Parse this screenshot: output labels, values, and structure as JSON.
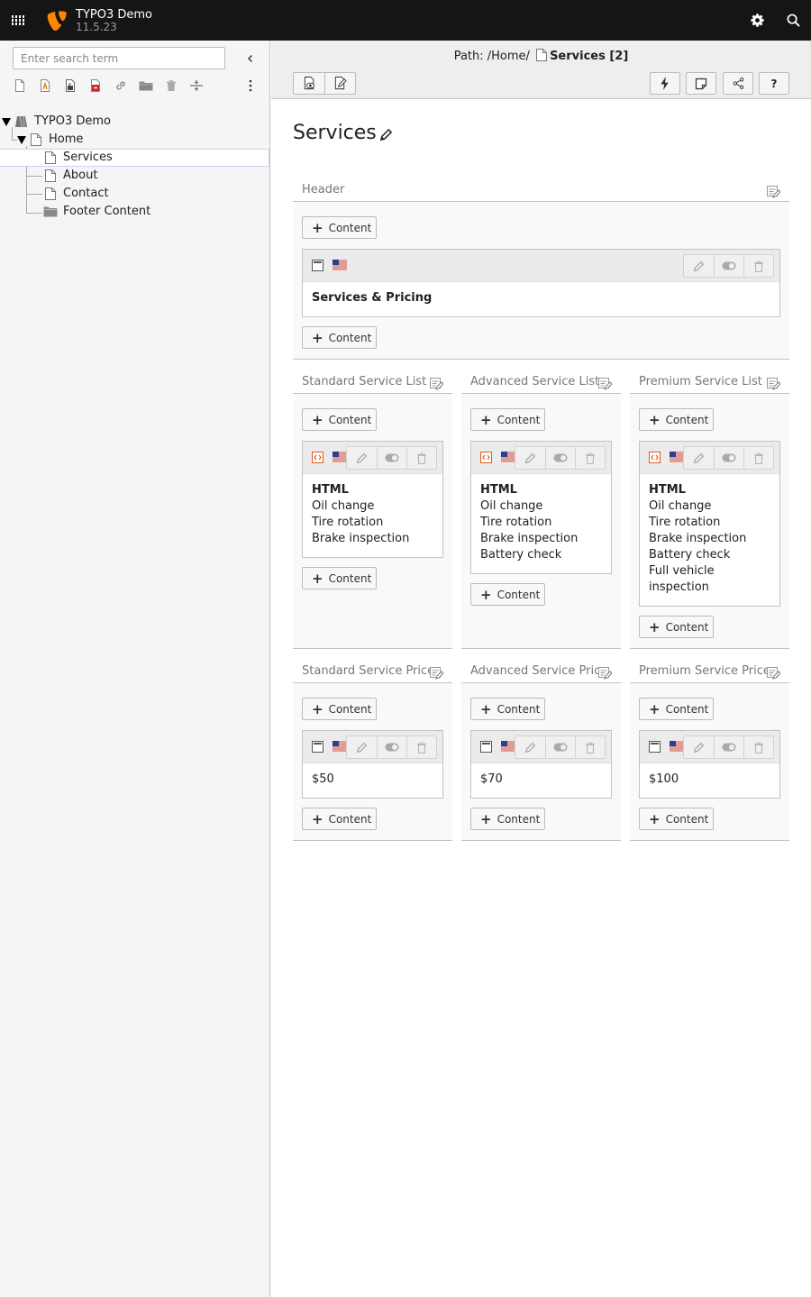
{
  "topbar": {
    "site_title": "TYPO3 Demo",
    "version": "11.5.23",
    "icons": [
      "apps-grid-icon",
      "typo3-logo-icon",
      "gear-icon",
      "search-icon"
    ]
  },
  "nav": {
    "search_placeholder": "Enter search term",
    "tools": [
      "page-new-icon",
      "page-shortcut-icon",
      "page-mountpoint-icon",
      "page-backend-user-icon",
      "page-link-icon",
      "folder-icon",
      "recycler-icon",
      "spacer-icon",
      "more-icon"
    ],
    "tree": [
      {
        "label": "TYPO3 Demo",
        "icon": "site-root-icon"
      },
      {
        "label": "Home",
        "icon": "page-icon"
      },
      {
        "label": "Services",
        "icon": "page-icon",
        "selected": true
      },
      {
        "label": "About",
        "icon": "page-icon"
      },
      {
        "label": "Contact",
        "icon": "page-icon"
      },
      {
        "label": "Footer Content",
        "icon": "folder-icon"
      }
    ]
  },
  "docheader": {
    "path_prefix": "Path: /Home/",
    "path_page": "Services [2]"
  },
  "page": {
    "title": "Services"
  },
  "content_label": "Content",
  "columns": {
    "header": {
      "name": "Header",
      "element": {
        "type": "text",
        "flag": "en-us",
        "bold": "Services & Pricing"
      }
    },
    "lists": [
      {
        "name": "Standard Service List",
        "title": "HTML",
        "lines": [
          "Oil change",
          "Tire rotation",
          "Brake inspection"
        ]
      },
      {
        "name": "Advanced Service List",
        "title": "HTML",
        "lines": [
          "Oil change",
          "Tire rotation",
          "Brake inspection",
          "Battery check"
        ]
      },
      {
        "name": "Premium Service List",
        "title": "HTML",
        "lines": [
          "Oil change",
          "Tire rotation",
          "Brake inspection",
          "Battery check",
          "Full vehicle",
          "inspection"
        ]
      }
    ],
    "prices": [
      {
        "name": "Standard Service Price",
        "value": "$50"
      },
      {
        "name": "Advanced Service Price",
        "value": "$70"
      },
      {
        "name": "Premium Service Price",
        "value": "$100"
      }
    ]
  },
  "colors": {
    "topbar": "#151515",
    "typo3_orange": "#ff8700",
    "html_icon": "#e05a1a",
    "nav_bg": "#f5f5f5"
  }
}
